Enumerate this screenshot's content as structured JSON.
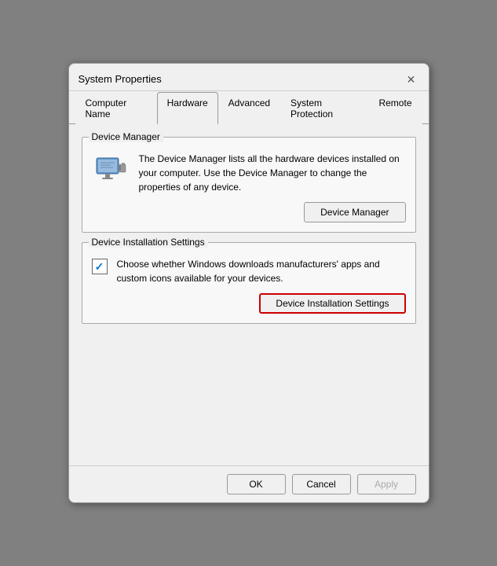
{
  "dialog": {
    "title": "System Properties",
    "close_label": "✕"
  },
  "tabs": [
    {
      "id": "computer-name",
      "label": "Computer Name",
      "active": false
    },
    {
      "id": "hardware",
      "label": "Hardware",
      "active": true
    },
    {
      "id": "advanced",
      "label": "Advanced",
      "active": false
    },
    {
      "id": "system-protection",
      "label": "System Protection",
      "active": false
    },
    {
      "id": "remote",
      "label": "Remote",
      "active": false
    }
  ],
  "sections": {
    "device_manager": {
      "label": "Device Manager",
      "description": "The Device Manager lists all the hardware devices installed on your computer. Use the Device Manager to change the properties of any device.",
      "button_label": "Device Manager"
    },
    "device_installation": {
      "label": "Device Installation Settings",
      "description": "Choose whether Windows downloads manufacturers' apps and custom icons available for your devices.",
      "button_label": "Device Installation Settings"
    }
  },
  "footer": {
    "ok_label": "OK",
    "cancel_label": "Cancel",
    "apply_label": "Apply"
  },
  "icons": {
    "close": "✕",
    "checkmark": "✓"
  }
}
